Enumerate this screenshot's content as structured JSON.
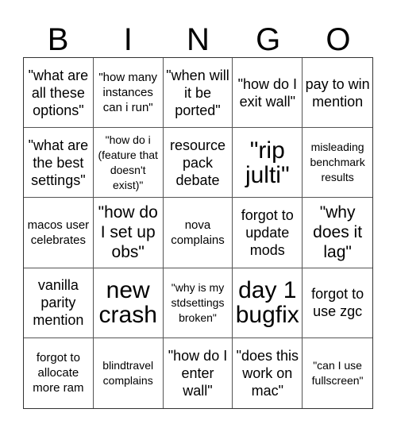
{
  "header": [
    "B",
    "I",
    "N",
    "G",
    "O"
  ],
  "cells": [
    {
      "text": "\"what are all these options\"",
      "size": "m"
    },
    {
      "text": "\"how many instances can i run\"",
      "size": "s"
    },
    {
      "text": "\"when will it be ported\"",
      "size": "m"
    },
    {
      "text": "\"how do I exit wall\"",
      "size": "m"
    },
    {
      "text": "pay to win mention",
      "size": "m"
    },
    {
      "text": "\"what are the best settings\"",
      "size": "m"
    },
    {
      "text": "\"how do i (feature that doesn't exist)\"",
      "size": "xs"
    },
    {
      "text": "resource pack debate",
      "size": "m"
    },
    {
      "text": "\"rip julti\"",
      "size": "xl"
    },
    {
      "text": "misleading benchmark results",
      "size": "xs"
    },
    {
      "text": "macos user celebrates",
      "size": "s"
    },
    {
      "text": "\"how do I set up obs\"",
      "size": "l"
    },
    {
      "text": "nova complains",
      "size": "s"
    },
    {
      "text": "forgot to update mods",
      "size": "m"
    },
    {
      "text": "\"why does it lag\"",
      "size": "l"
    },
    {
      "text": "vanilla parity mention",
      "size": "m"
    },
    {
      "text": "new crash",
      "size": "xl"
    },
    {
      "text": "\"why is my stdsettings broken\"",
      "size": "xs"
    },
    {
      "text": "day 1 bugfix",
      "size": "xl"
    },
    {
      "text": "forgot to use zgc",
      "size": "m"
    },
    {
      "text": "forgot to allocate more ram",
      "size": "s"
    },
    {
      "text": "blindtravel complains",
      "size": "xs"
    },
    {
      "text": "\"how do I enter wall\"",
      "size": "m"
    },
    {
      "text": "\"does this work on mac\"",
      "size": "m"
    },
    {
      "text": "\"can I use fullscreen\"",
      "size": "xs"
    }
  ]
}
